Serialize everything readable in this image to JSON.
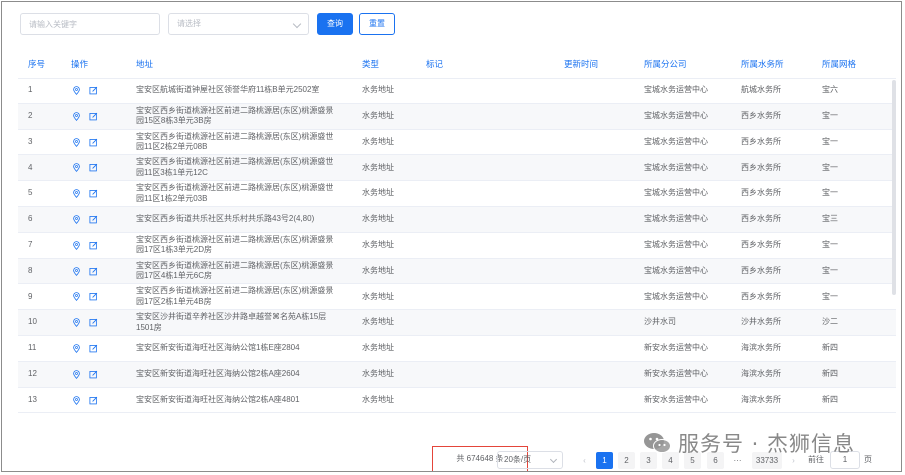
{
  "filters": {
    "keyword_placeholder": "请输入关键字",
    "select_placeholder": "请选择",
    "search_label": "查询",
    "reset_label": "重置"
  },
  "table": {
    "columns": [
      "序号",
      "操作",
      "地址",
      "类型",
      "标记",
      "更新时间",
      "所属分公司",
      "所属水务所",
      "所属网格"
    ],
    "rows": [
      {
        "no": "1",
        "addr1": "宝安区航城街道钟屋社区领誉华府11栋B单元2502室",
        "addr2": "",
        "type": "水务地址",
        "company": "宝城水务运营中心",
        "office": "航城水务所",
        "grid": "宝六"
      },
      {
        "no": "2",
        "addr1": "宝安区西乡街道桃源社区前进二路桃源居(东区)桃源盛景",
        "addr2": "园15区8栋3单元3B房",
        "type": "水务地址",
        "company": "宝城水务运营中心",
        "office": "西乡水务所",
        "grid": "宝一"
      },
      {
        "no": "3",
        "addr1": "宝安区西乡街道桃源社区前进二路桃源居(东区)桃源盛世",
        "addr2": "园11区2栋2单元08B",
        "type": "水务地址",
        "company": "宝城水务运营中心",
        "office": "西乡水务所",
        "grid": "宝一"
      },
      {
        "no": "4",
        "addr1": "宝安区西乡街道桃源社区前进二路桃源居(东区)桃源盛世",
        "addr2": "园11区3栋1单元12C",
        "type": "水务地址",
        "company": "宝城水务运营中心",
        "office": "西乡水务所",
        "grid": "宝一"
      },
      {
        "no": "5",
        "addr1": "宝安区西乡街道桃源社区前进二路桃源居(东区)桃源盛世",
        "addr2": "园11区1栋2单元03B",
        "type": "水务地址",
        "company": "宝城水务运营中心",
        "office": "西乡水务所",
        "grid": "宝一"
      },
      {
        "no": "6",
        "addr1": "宝安区西乡街道共乐社区共乐村共乐路43号2(4,80)",
        "addr2": "",
        "type": "水务地址",
        "company": "宝城水务运营中心",
        "office": "西乡水务所",
        "grid": "宝三"
      },
      {
        "no": "7",
        "addr1": "宝安区西乡街道桃源社区前进二路桃源居(东区)桃源盛景",
        "addr2": "园17区1栋3单元2D房",
        "type": "水务地址",
        "company": "宝城水务运营中心",
        "office": "西乡水务所",
        "grid": "宝一"
      },
      {
        "no": "8",
        "addr1": "宝安区西乡街道桃源社区前进二路桃源居(东区)桃源盛景",
        "addr2": "园17区4栋1单元6C房",
        "type": "水务地址",
        "company": "宝城水务运营中心",
        "office": "西乡水务所",
        "grid": "宝一"
      },
      {
        "no": "9",
        "addr1": "宝安区西乡街道桃源社区前进二路桃源居(东区)桃源盛景",
        "addr2": "园17区2栋1单元4B房",
        "type": "水务地址",
        "company": "宝城水务运营中心",
        "office": "西乡水务所",
        "grid": "宝一"
      },
      {
        "no": "10",
        "addr1": "宝安区沙井街道辛养社区沙井路卓越誉⌘名苑A栋15层",
        "addr2": "1501房",
        "type": "水务地址",
        "company": "沙井水司",
        "office": "沙井水务所",
        "grid": "沙二"
      },
      {
        "no": "11",
        "addr1": "宝安区新安街道海旺社区海纳公馆1栋E座2804",
        "addr2": "",
        "type": "水务地址",
        "company": "新安水务运营中心",
        "office": "海滨水务所",
        "grid": "新四"
      },
      {
        "no": "12",
        "addr1": "宝安区新安街道海旺社区海纳公馆2栋A座2604",
        "addr2": "",
        "type": "水务地址",
        "company": "新安水务运营中心",
        "office": "海滨水务所",
        "grid": "新四"
      },
      {
        "no": "13",
        "addr1": "宝安区新安街道海旺社区海纳公馆2栋A座4801",
        "addr2": "",
        "type": "水务地址",
        "company": "新安水务运营中心",
        "office": "海滨水务所",
        "grid": "新四"
      }
    ]
  },
  "pagination": {
    "total_text": "共 674648 条",
    "page_size": "20条/页",
    "pages": [
      "1",
      "2",
      "3",
      "4",
      "5",
      "6",
      "···",
      "33733"
    ],
    "current": "1",
    "goto_label": "前往",
    "goto_value": "1",
    "page_unit": "页"
  },
  "watermark": {
    "text": "服务号 · 杰狮信息"
  },
  "colors": {
    "accent": "#1a72f0",
    "highlight_border": "#e4453a"
  }
}
